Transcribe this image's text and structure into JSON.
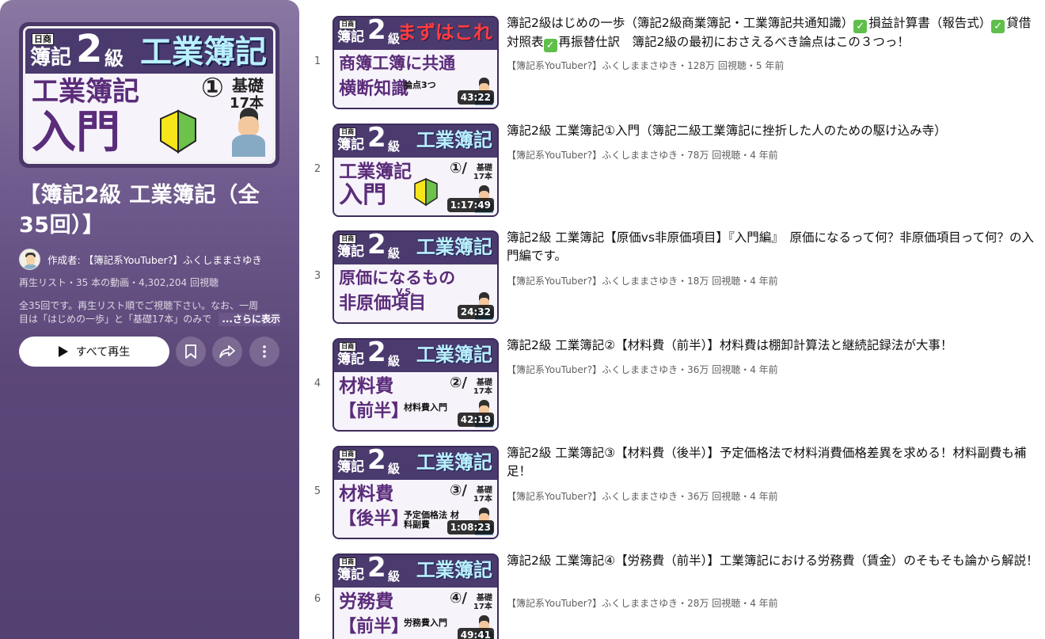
{
  "playlist": {
    "cover": {
      "badge": "日商",
      "boki": "簿記",
      "grade_number": "2",
      "grade_suffix": "級",
      "subject": "工業簿記",
      "title_line": "工業簿記",
      "big_text": "入門",
      "lesson": "①",
      "series": "基礎",
      "count": "17本"
    },
    "title": "【簿記2級 工業簿記（全35回）】",
    "author_prefix": "作成者:",
    "author": "【簿記系YouTuber?】ふくしままさゆき",
    "stats": "再生リスト・35 本の動画・4,302,204 回視聴",
    "description_line1": "全35回です。再生リスト順でご視聴下さい。なお、一周",
    "description_line2": "目は「はじめの一歩」と「基礎17本」のみで",
    "description_more": "...さらに表示",
    "play_all_label": "すべて再生",
    "icons": {
      "save": "bookmark-icon",
      "share": "share-icon",
      "more": "more-vert-icon",
      "play": "play-icon"
    },
    "gradient_top": "#8a78a3",
    "gradient_bottom": "#524070"
  },
  "videos": [
    {
      "index": "1",
      "duration": "43:22",
      "title_parts": [
        {
          "type": "text",
          "text": "簿記2級はじめの一歩（簿記2級商業簿記・工業簿記共通知識）"
        },
        {
          "type": "check"
        },
        {
          "type": "text",
          "text": "損益計算書（報告式）"
        },
        {
          "type": "check"
        },
        {
          "type": "text",
          "text": "貸借対照表"
        },
        {
          "type": "check"
        },
        {
          "type": "text",
          "text": "再振替仕訳　簿記2級の最初におさえるべき論点はこの３つっ！"
        }
      ],
      "channel": "【簿記系YouTuber?】ふくしままさゆき",
      "views": "128万 回視聴",
      "age": "5 年前",
      "thumb": {
        "head": "まずはこれ",
        "main": "商簿工簿に共通",
        "main2": "横断知識",
        "num": "",
        "num2": "",
        "sub": "論点3つ",
        "head_color": "#ff3d3d",
        "leaf": false
      }
    },
    {
      "index": "2",
      "duration": "1:17:49",
      "title_parts": [
        {
          "type": "text",
          "text": "簿記2級 工業簿記①入門（簿記二級工業簿記に挫折した人のための駆け込み寺）"
        }
      ],
      "channel": "【簿記系YouTuber?】ふくしままさゆき",
      "views": "78万 回視聴",
      "age": "4 年前",
      "thumb": {
        "head": "工業簿記",
        "main": "工業簿記",
        "main2": "入門",
        "num": "①/",
        "num2": "基礎 17本",
        "sub": "",
        "head_color": "#b8f0ff",
        "leaf": true
      }
    },
    {
      "index": "3",
      "duration": "24:32",
      "title_parts": [
        {
          "type": "text",
          "text": "簿記2級 工業簿記【原価vs非原価項目】『入門編』　原価になるって何？非原価項目って何？の入門編です。"
        }
      ],
      "channel": "【簿記系YouTuber?】ふくしままさゆき",
      "views": "18万 回視聴",
      "age": "4 年前",
      "thumb": {
        "head": "工業簿記",
        "main": "原価になるもの",
        "main2": "非原価項目",
        "num": "",
        "num2": "",
        "sub": "V.S.",
        "head_color": "#b8f0ff",
        "leaf": false
      }
    },
    {
      "index": "4",
      "duration": "42:19",
      "title_parts": [
        {
          "type": "text",
          "text": "簿記2級 工業簿記②【材料費（前半）】材料費は棚卸計算法と継続記録法が大事！"
        }
      ],
      "channel": "【簿記系YouTuber?】ふくしままさゆき",
      "views": "36万 回視聴",
      "age": "4 年前",
      "thumb": {
        "head": "工業簿記",
        "main": "材料費",
        "main2": "【前半】",
        "num": "②/",
        "num2": "基礎 17本",
        "sub": "材料費入門",
        "head_color": "#b8f0ff",
        "leaf": false
      }
    },
    {
      "index": "5",
      "duration": "1:08:23",
      "title_parts": [
        {
          "type": "text",
          "text": "簿記2級 工業簿記③【材料費（後半）】予定価格法で材料消費価格差異を求める！材料副費も補足！"
        }
      ],
      "channel": "【簿記系YouTuber?】ふくしままさゆき",
      "views": "36万 回視聴",
      "age": "4 年前",
      "thumb": {
        "head": "工業簿記",
        "main": "材料費",
        "main2": "【後半】",
        "num": "③/",
        "num2": "基礎 17本",
        "sub": "予定価格法 材料副費",
        "head_color": "#b8f0ff",
        "leaf": false
      }
    },
    {
      "index": "6",
      "duration": "49:41",
      "title_parts": [
        {
          "type": "text",
          "text": "簿記2級 工業簿記④【労務費（前半）】工業簿記における労務費（賃金）のそもそも論から解説！"
        }
      ],
      "channel": "【簿記系YouTuber?】ふくしままさゆき",
      "views": "28万 回視聴",
      "age": "4 年前",
      "thumb": {
        "head": "工業簿記",
        "main": "労務費",
        "main2": "【前半】",
        "num": "④/",
        "num2": "基礎 17本",
        "sub": "労務費入門",
        "head_color": "#b8f0ff",
        "leaf": false
      }
    }
  ],
  "meta_separator": "・"
}
